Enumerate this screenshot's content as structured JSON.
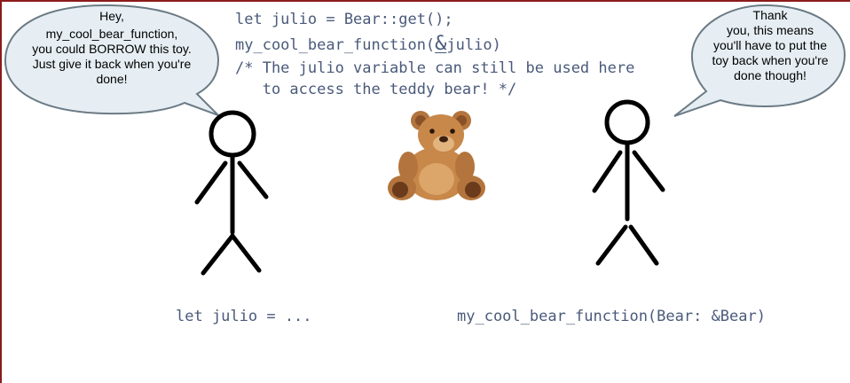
{
  "left_bubble": {
    "lines": [
      "Hey,",
      "my_cool_bear_function,",
      "you could BORROW this toy.",
      "Just give it back when you're",
      "done!"
    ]
  },
  "right_bubble": {
    "lines": [
      "Thank",
      "you, this means",
      "you'll have to put the",
      "toy back when you're",
      "done though!"
    ]
  },
  "code": {
    "line1": "let julio = Bear::get();",
    "line2_prefix": "my_cool_bear_function(",
    "line2_amp": "&",
    "line2_suffix": "julio)",
    "line3": "/* The julio variable can still be used here",
    "line4": "   to access the teddy bear! */"
  },
  "captions": {
    "left": "let julio = ...",
    "right": "my_cool_bear_function(Bear: &Bear)"
  },
  "colors": {
    "code_text": "#4a5a7a",
    "bubble_fill": "#e6eef3",
    "bubble_stroke": "#6b7b85",
    "frame": "#8b1a1a",
    "bear_fur": "#c8884a"
  }
}
